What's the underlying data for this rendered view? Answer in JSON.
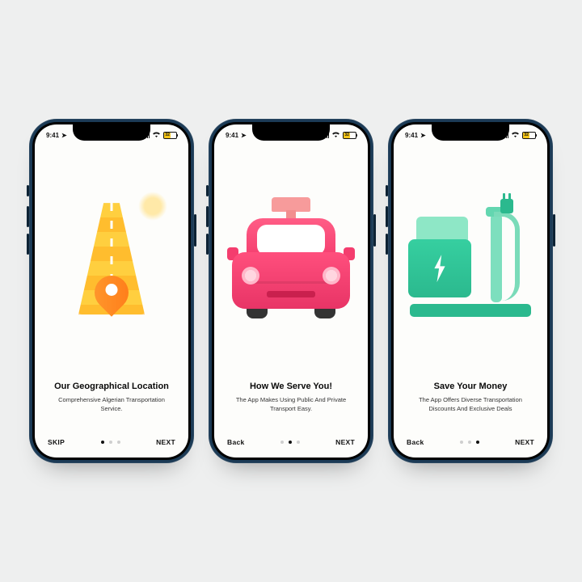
{
  "status": {
    "time": "9:41",
    "battery_pct": "32"
  },
  "screens": [
    {
      "title": "Our Geographical Location",
      "subtitle": "Comprehensive Algerian Transportation Service.",
      "left_action": "SKIP",
      "right_action": "NEXT",
      "active_dot": 0
    },
    {
      "title": "How We Serve You!",
      "subtitle": "The App Makes Using Public And Private Transport Easy.",
      "left_action": "Back",
      "right_action": "NEXT",
      "active_dot": 1
    },
    {
      "title": "Save Your Money",
      "subtitle": "The App Offers Diverse Transportation Discounts And Exclusive Deals",
      "left_action": "Back",
      "right_action": "NEXT",
      "active_dot": 2
    }
  ]
}
